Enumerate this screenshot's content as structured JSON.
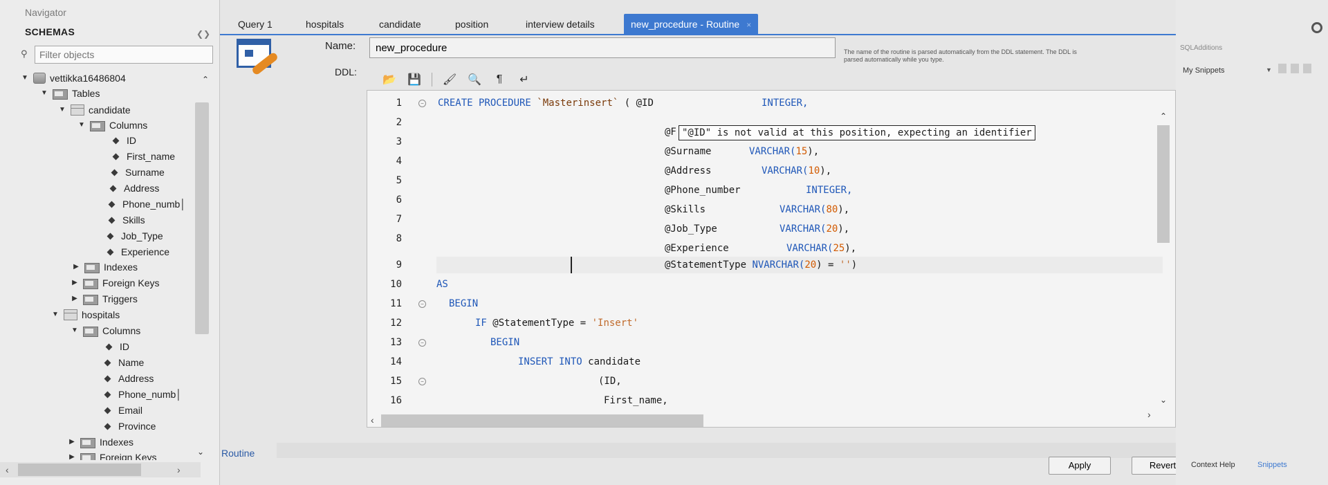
{
  "navigator": {
    "title": "Navigator",
    "schemas_label": "SCHEMAS",
    "filter_placeholder": "Filter objects",
    "tree": {
      "schema": "vettikka16486804",
      "tables_label": "Tables",
      "candidate": {
        "name": "candidate",
        "columns_label": "Columns",
        "columns": [
          "ID",
          "First_name",
          "Surname",
          "Address",
          "Phone_numb│",
          "Skills",
          "Job_Type",
          "Experience"
        ],
        "indexes_label": "Indexes",
        "foreign_keys_label": "Foreign Keys",
        "triggers_label": "Triggers"
      },
      "hospitals": {
        "name": "hospitals",
        "columns_label": "Columns",
        "columns": [
          "ID",
          "Name",
          "Address",
          "Phone_numb│",
          "Email",
          "Province"
        ],
        "indexes_label": "Indexes",
        "foreign_keys_label": "Foreign Keys"
      }
    }
  },
  "tabs": [
    {
      "label": "Query 1"
    },
    {
      "label": "hospitals"
    },
    {
      "label": "candidate"
    },
    {
      "label": "position"
    },
    {
      "label": "interview details"
    },
    {
      "label": "new_procedure - Routine",
      "close": "×"
    }
  ],
  "routine": {
    "name_label": "Name:",
    "name_value": "new_procedure",
    "name_hint": "The name of the routine is parsed automatically from the DDL statement. The DDL is parsed automatically while you type.",
    "ddl_label": "DDL:"
  },
  "editor": {
    "line_numbers": [
      "1",
      "2",
      "3",
      "4",
      "5",
      "6",
      "7",
      "8",
      "9",
      "10",
      "11",
      "12",
      "13",
      "14",
      "15",
      "16"
    ],
    "error_tooltip": "\"@ID\" is not valid at this position, expecting an identifier",
    "code": {
      "l1_kw": "CREATE PROCEDURE",
      "l1_ident": "`Masterinsert`",
      "l1_paren": "( @ID",
      "l1_type": "INTEGER,",
      "l2_var": "@F",
      "l3_var": "@Surname",
      "l3_type": "VARCHAR(",
      "l3_num": "15",
      "l3_end": "),",
      "l4_var": "@Address",
      "l4_type": "VARCHAR(",
      "l4_num": "10",
      "l4_end": "),",
      "l5_var": "@Phone_number",
      "l5_type": "INTEGER,",
      "l6_var": "@Skills",
      "l6_type": "VARCHAR(",
      "l6_num": "80",
      "l6_end": "),",
      "l7_var": "@Job_Type",
      "l7_type": "VARCHAR(",
      "l7_num": "20",
      "l7_end": "),",
      "l8_var": "@Experience",
      "l8_type": "VARCHAR(",
      "l8_num": "25",
      "l8_end": "),",
      "l9_var": "@StatementType",
      "l9_type": "NVARCHAR(",
      "l9_num": "20",
      "l9_mid": ") =",
      "l9_str": "''",
      "l9_end": ")",
      "l10_kw": "AS",
      "l11_kw": "BEGIN",
      "l12_kw": "IF",
      "l12_var": "@StatementType =",
      "l12_str": "'Insert'",
      "l13_kw": "BEGIN",
      "l14_kw": "INSERT INTO",
      "l14_tbl": "candidate",
      "l15_text": "(ID,",
      "l16_text": "First_name,"
    }
  },
  "bottom": {
    "routine_tab": "Routine",
    "apply_label": "Apply",
    "revert_label": "Revert"
  },
  "right_panel": {
    "title": "SQLAdditions",
    "snippets_label": "My Snippets",
    "context_help": "Context Help",
    "snippets_tab": "Snippets"
  }
}
